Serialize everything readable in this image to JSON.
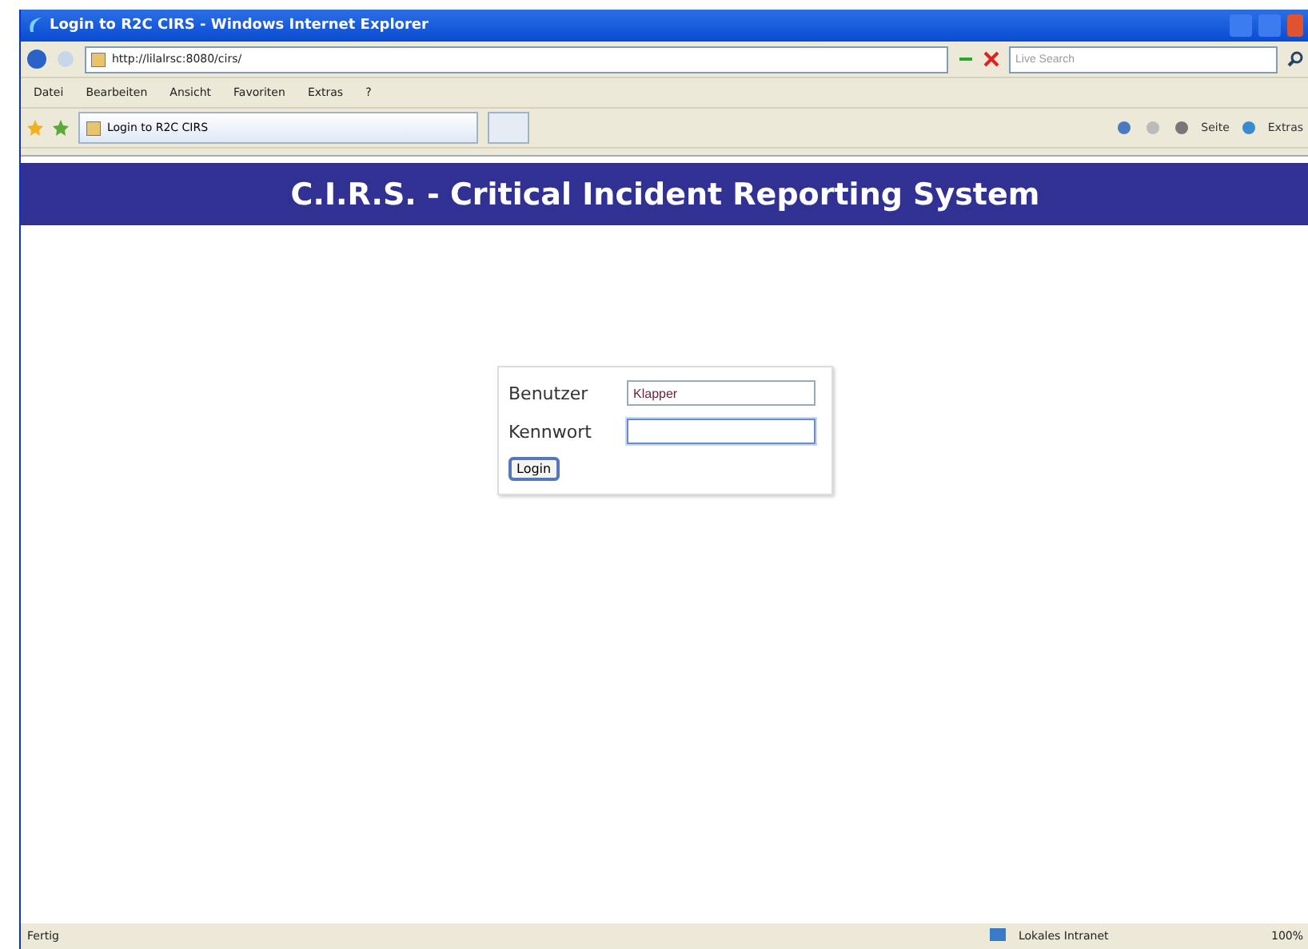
{
  "window": {
    "title": "Login to R2C CIRS - Windows Internet Explorer"
  },
  "address_bar": {
    "value": "http://lilalrsc:8080/cirs/"
  },
  "search": {
    "placeholder": "Live Search"
  },
  "menu": [
    "Datei",
    "Bearbeiten",
    "Ansicht",
    "Favoriten",
    "Extras",
    "?"
  ],
  "tabs": [
    {
      "label": "Login to R2C CIRS",
      "selected": true
    }
  ],
  "toolbar": [
    "Seite",
    "Extras"
  ],
  "page": {
    "banner": "C.I.R.S. - Critical Incident Reporting System",
    "form": {
      "fields": [
        {
          "label": "Benutzer",
          "value": "Klapper",
          "focused": false
        },
        {
          "label": "Kennwort",
          "focused": true
        }
      ],
      "button": "Login"
    }
  },
  "status_bar": {
    "text": "Fertig",
    "zone": "Lokales Intranet",
    "zoom": "100%"
  }
}
